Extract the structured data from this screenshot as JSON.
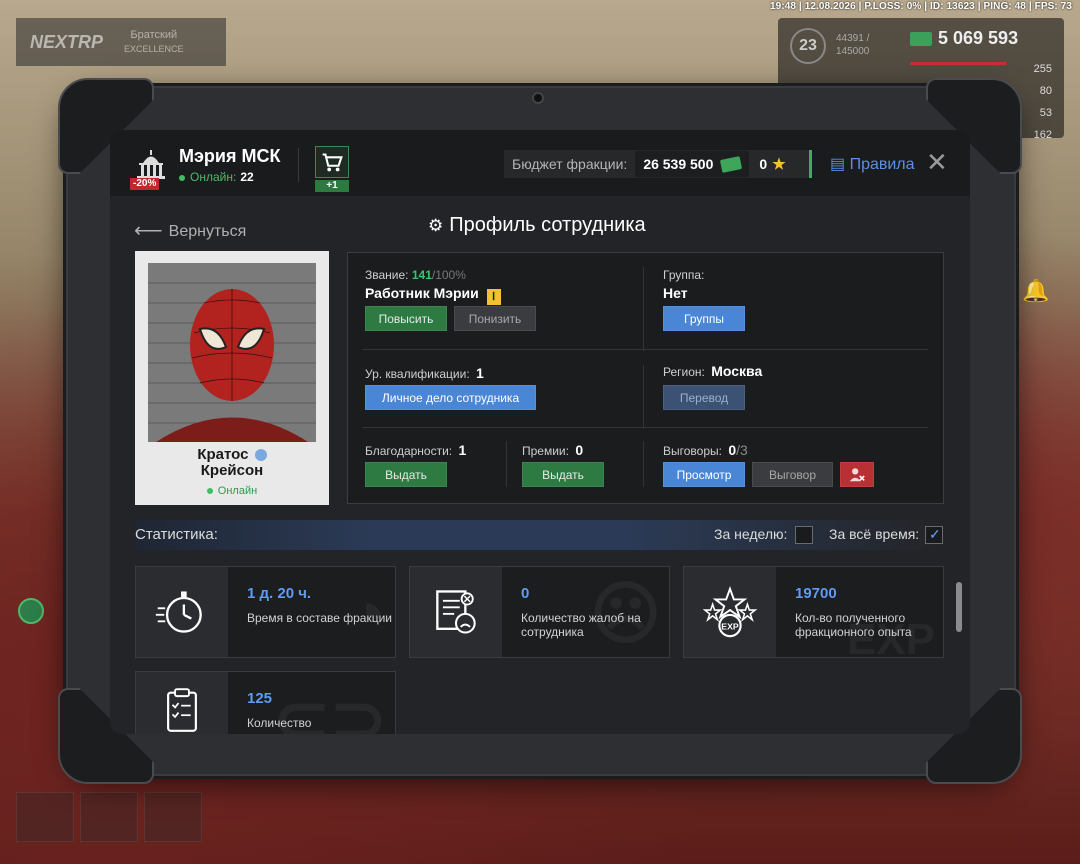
{
  "hud": {
    "topbar": "19:48 | 12.08.2026 | P.LOSS: 0% | ID: 13623 | PING: 48 | FPS: 73",
    "logo": "NEXTRP",
    "server_name": "Братский",
    "server_sub": "EXCELLENCE",
    "level": "23",
    "xp": "44391 /",
    "xp_max": "145000",
    "money": "5 069 593",
    "stats": [
      "255",
      "80",
      "53",
      "162"
    ]
  },
  "header": {
    "org_name": "Мэрия МСК",
    "org_discount": "-20%",
    "online_label": "Онлайн:",
    "online_count": "22",
    "cart_badge": "+1",
    "budget_label": "Бюджет фракции:",
    "budget_value": "26 539 500",
    "stars_value": "0",
    "rules_label": "Правила",
    "close": "✕"
  },
  "nav": {
    "back_label": "Вернуться",
    "page_title": "Профиль сотрудника"
  },
  "employee": {
    "name_line1": "Кратос",
    "name_line2": "Крейсон",
    "status": "Онлайн"
  },
  "info": {
    "rank_label": "Звание:",
    "rank_progress": "141",
    "rank_progress_max": "/100%",
    "rank_name": "Работник Мэрии",
    "promote_btn": "Повысить",
    "demote_btn": "Понизить",
    "group_label": "Группа:",
    "group_value": "Нет",
    "groups_btn": "Группы",
    "qual_label": "Ур. квалификации:",
    "qual_value": "1",
    "dossier_btn": "Личное дело сотрудника",
    "region_label": "Регион:",
    "region_value": "Москва",
    "transfer_btn": "Перевод",
    "thanks_label": "Благодарности:",
    "thanks_value": "1",
    "thanks_btn": "Выдать",
    "bonus_label": "Премии:",
    "bonus_value": "0",
    "bonus_btn": "Выдать",
    "reprimand_label": "Выговоры:",
    "reprimand_value": "0",
    "reprimand_max": "/3",
    "view_btn": "Просмотр",
    "reprimand_btn": "Выговор"
  },
  "stats": {
    "title": "Статистика:",
    "week_label": "За неделю:",
    "week_checked": false,
    "all_label": "За всё время:",
    "all_checked": true,
    "cards": [
      {
        "value": "1 д. 20 ч.",
        "text": "Время в составе фракции",
        "icon": "stopwatch-icon"
      },
      {
        "value": "0",
        "text": "Количество жалоб на сотрудника",
        "icon": "complaint-icon"
      },
      {
        "value": "19700",
        "text": "Кол-во полученного фракционного опыта",
        "icon": "exp-icon",
        "watermark": "EXP"
      },
      {
        "value": "125",
        "text": "Количество",
        "icon": "clipboard-icon"
      }
    ]
  },
  "colors": {
    "accent_blue": "#4a86d6",
    "accent_green": "#2d7a43",
    "danger": "#b82f34",
    "stat_value": "#5f9bf0"
  }
}
